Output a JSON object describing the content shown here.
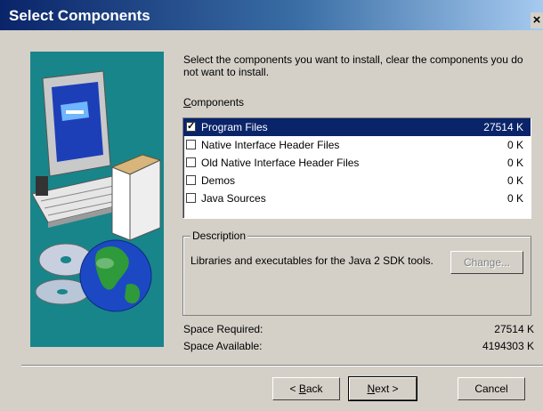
{
  "window": {
    "title": "Select Components",
    "close_glyph": "×"
  },
  "instruction": "Select the components you want to install, clear the components you do not want to install.",
  "components": {
    "label_first": "C",
    "label_rest": "omponents",
    "items": [
      {
        "name": "Program Files",
        "size": "27514 K",
        "checked": true,
        "selected": true
      },
      {
        "name": "Native Interface Header Files",
        "size": "0 K",
        "checked": false,
        "selected": false
      },
      {
        "name": "Old Native  Interface Header Files",
        "size": "0 K",
        "checked": false,
        "selected": false
      },
      {
        "name": "Demos",
        "size": "0 K",
        "checked": false,
        "selected": false
      },
      {
        "name": "Java Sources",
        "size": "0 K",
        "checked": false,
        "selected": false
      }
    ],
    "check_glyph": "✓"
  },
  "description": {
    "legend": "Description",
    "text": "Libraries and executables for the Java 2 SDK tools.",
    "change_label": "Change..."
  },
  "space": {
    "required_label": "Space Required:",
    "required_value": "27514 K",
    "available_label": "Space Available:",
    "available_value": "4194303 K"
  },
  "buttons": {
    "back_prefix": "< ",
    "back_underline": "B",
    "back_rest": "ack",
    "next_underline": "N",
    "next_rest": "ext >",
    "cancel": "Cancel"
  },
  "colors": {
    "titlebar_start": "#0a246a",
    "titlebar_end": "#a6caf0",
    "art_background": "#18858a",
    "selection": "#0a246a",
    "dialog": "#d4d0c8"
  },
  "icons": {
    "art": [
      "computer-monitor-icon",
      "computer-box-icon",
      "cd-discs-icon",
      "globe-icon"
    ]
  }
}
